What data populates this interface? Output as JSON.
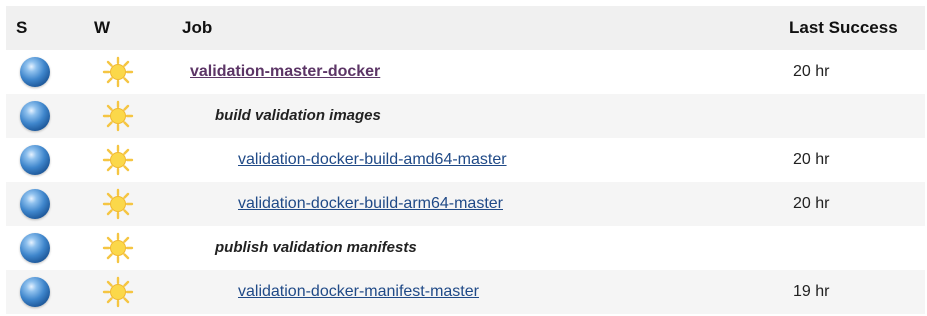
{
  "headers": {
    "s": "S",
    "w": "W",
    "job": "Job",
    "last_success": "Last Success"
  },
  "icons": {
    "status": "blue-ball-icon",
    "weather": "sunny-weather-icon",
    "status_color": "#3f86cc",
    "weather_color": "#f7c948"
  },
  "rows": [
    {
      "type": "job",
      "name": "validation-master-docker",
      "last_success": "20 hr"
    },
    {
      "type": "group",
      "name": "build validation images",
      "last_success": ""
    },
    {
      "type": "job",
      "name": "validation-docker-build-amd64-master",
      "last_success": "20 hr"
    },
    {
      "type": "job",
      "name": "validation-docker-build-arm64-master",
      "last_success": "20 hr"
    },
    {
      "type": "group",
      "name": "publish validation manifests",
      "last_success": ""
    },
    {
      "type": "job",
      "name": "validation-docker-manifest-master",
      "last_success": "19 hr"
    }
  ]
}
